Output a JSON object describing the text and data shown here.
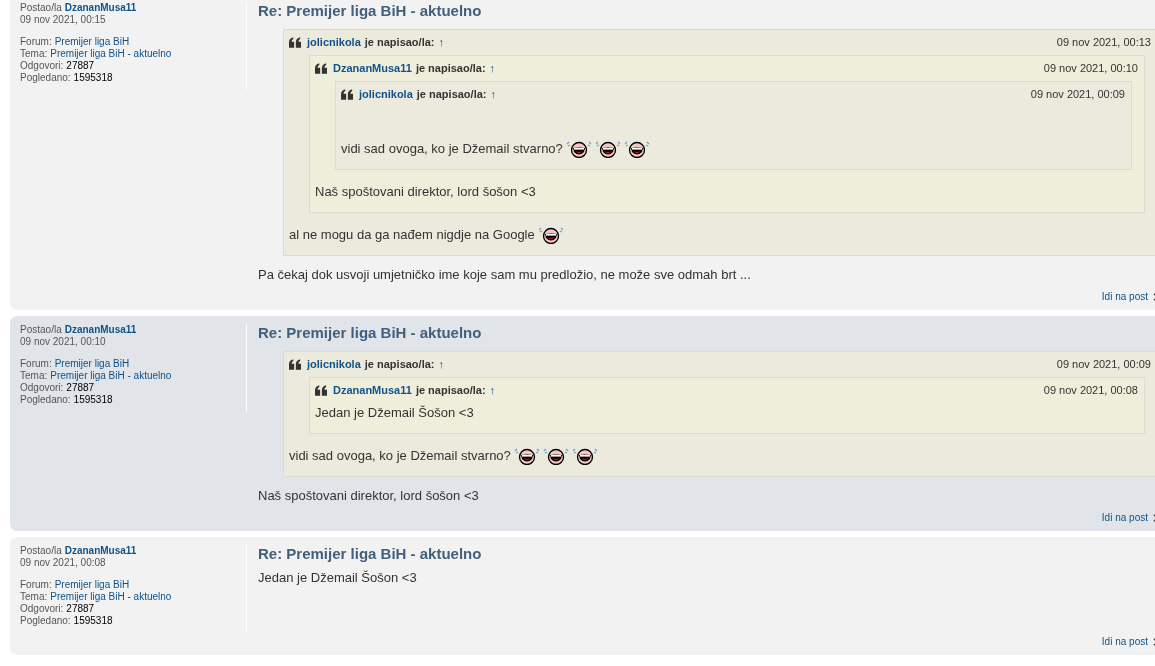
{
  "posts": [
    {
      "kind": "light",
      "author_label": "Postao/la",
      "author": "DzananMusa11",
      "time": "09 nov 2021, 00:15",
      "forum_label": "Forum:",
      "forum": "Premijer liga BiH",
      "topic_label": "Tema:",
      "topic": "Premijer liga BiH - aktuelno",
      "replies_label": "Odgovori:",
      "replies": "27887",
      "views_label": "Pogledano:",
      "views": "1595318",
      "title": "Re: Premijer liga BiH - aktuelno",
      "go_link": "Idi na post",
      "content": [
        {
          "kind": "quote",
          "author": "jolicnikola",
          "wrote": "je napisao/la:",
          "up": "↑",
          "date": "09 nov 2021, 00:13",
          "content": [
            {
              "kind": "quote",
              "author": "DzananMusa11",
              "wrote": "je napisao/la:",
              "up": "↑",
              "date": "09 nov 2021, 00:10",
              "content": [
                {
                  "kind": "quote",
                  "author": "jolicnikola",
                  "wrote": "je napisao/la:",
                  "up": "↑",
                  "date": "09 nov 2021, 00:09",
                  "gap": true,
                  "content": [
                    {
                      "kind": "text",
                      "parts": [
                        {
                          "kind": "text",
                          "text": "vidi sad ovoga, ko je Džemail stvarno?"
                        },
                        {
                          "kind": "smiley"
                        },
                        {
                          "kind": "smiley"
                        },
                        {
                          "kind": "smiley"
                        }
                      ]
                    }
                  ]
                },
                {
                  "kind": "text",
                  "parts": [
                    {
                      "kind": "text",
                      "text": "Naš spoštovani direktor, lord šošon <3"
                    }
                  ]
                }
              ]
            },
            {
              "kind": "text",
              "parts": [
                {
                  "kind": "text",
                  "text": "al ne mogu da ga nađem nigdje na Google"
                },
                {
                  "kind": "smiley"
                }
              ]
            }
          ]
        },
        {
          "kind": "text",
          "parts": [
            {
              "kind": "text",
              "text": "Pa čekaj dok usvoji umjetničko ime koje sam mu predložio, ne može sve odmah brt ..."
            }
          ]
        }
      ]
    },
    {
      "kind": "dark",
      "author_label": "Postao/la",
      "author": "DzananMusa11",
      "time": "09 nov 2021, 00:10",
      "forum_label": "Forum:",
      "forum": "Premijer liga BiH",
      "topic_label": "Tema:",
      "topic": "Premijer liga BiH - aktuelno",
      "replies_label": "Odgovori:",
      "replies": "27887",
      "views_label": "Pogledano:",
      "views": "1595318",
      "title": "Re: Premijer liga BiH - aktuelno",
      "go_link": "Idi na post",
      "content": [
        {
          "kind": "quote",
          "author": "jolicnikola",
          "wrote": "je napisao/la:",
          "up": "↑",
          "date": "09 nov 2021, 00:09",
          "content": [
            {
              "kind": "quote",
              "author": "DzananMusa11",
              "wrote": "je napisao/la:",
              "up": "↑",
              "date": "09 nov 2021, 00:08",
              "content": [
                {
                  "kind": "text",
                  "parts": [
                    {
                      "kind": "text",
                      "text": "Jedan je Džemail Šošon <3"
                    }
                  ]
                }
              ]
            },
            {
              "kind": "text",
              "parts": [
                {
                  "kind": "text",
                  "text": "vidi sad ovoga, ko je Džemail stvarno?"
                },
                {
                  "kind": "smiley"
                },
                {
                  "kind": "smiley"
                },
                {
                  "kind": "smiley"
                }
              ]
            }
          ]
        },
        {
          "kind": "text",
          "parts": [
            {
              "kind": "text",
              "text": "Naš spoštovani direktor, lord šošon <3"
            }
          ]
        }
      ]
    },
    {
      "kind": "light",
      "author_label": "Postao/la",
      "author": "DzananMusa11",
      "time": "09 nov 2021, 00:08",
      "forum_label": "Forum:",
      "forum": "Premijer liga BiH",
      "topic_label": "Tema:",
      "topic": "Premijer liga BiH - aktuelno",
      "replies_label": "Odgovori:",
      "replies": "27887",
      "views_label": "Pogledano:",
      "views": "1595318",
      "title": "Re: Premijer liga BiH - aktuelno",
      "go_link": "Idi na post",
      "content": [
        {
          "kind": "text",
          "parts": [
            {
              "kind": "text",
              "text": "Jedan je Džemail Šošon <3"
            }
          ]
        }
      ]
    }
  ]
}
